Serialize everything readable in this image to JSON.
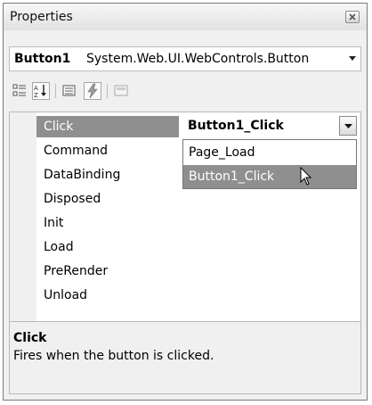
{
  "window": {
    "title": "Properties"
  },
  "object_selector": {
    "name": "Button1",
    "type": "System.Web.UI.WebControls.Button"
  },
  "events": [
    {
      "label": "Click"
    },
    {
      "label": "Command"
    },
    {
      "label": "DataBinding"
    },
    {
      "label": "Disposed"
    },
    {
      "label": "Init"
    },
    {
      "label": "Load"
    },
    {
      "label": "PreRender"
    },
    {
      "label": "Unload"
    }
  ],
  "selected_event": "Click",
  "value": "Button1_Click",
  "dropdown_options": [
    "Page_Load",
    "Button1_Click"
  ],
  "description": {
    "title": "Click",
    "text": "Fires when the button is clicked."
  },
  "toolbar": {
    "icons": [
      "categorized-icon",
      "alphabetical-icon",
      "properties-icon",
      "events-icon",
      "property-pages-icon"
    ]
  },
  "colors": {
    "selection": "#8f8f8f",
    "background": "#f0f0f0"
  }
}
